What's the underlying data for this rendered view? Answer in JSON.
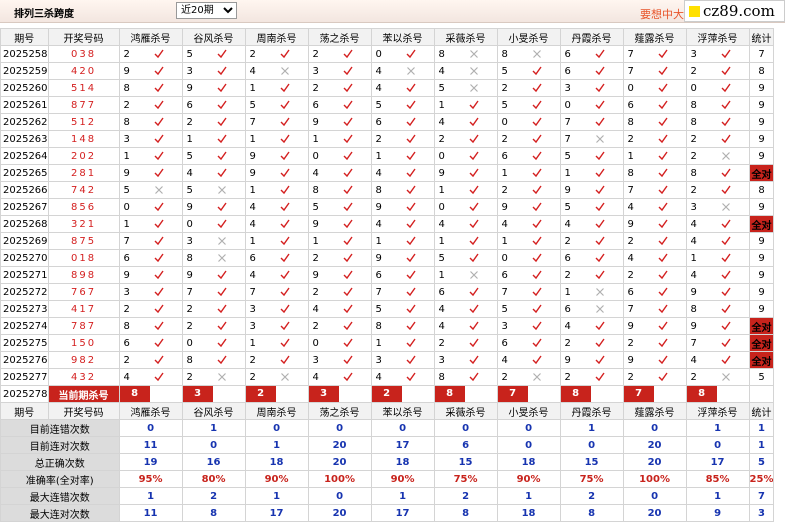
{
  "toolbar": {
    "title": "排列三杀跨度",
    "period_selected": "近20期",
    "more_text": "要想中大奖"
  },
  "logo": {
    "text": "cz89.com"
  },
  "columns": [
    "期号",
    "开奖号码",
    "鸿雁杀号",
    "谷风杀号",
    "周南杀号",
    "荡之杀号",
    "苯以杀号",
    "采薇杀号",
    "小旻杀号",
    "丹霞杀号",
    "薤露杀号",
    "浮萍杀号",
    "统计"
  ],
  "rows": [
    {
      "period": "2025258",
      "draw": "038",
      "p": [
        [
          "2",
          1
        ],
        [
          "5",
          1
        ],
        [
          "2",
          1
        ],
        [
          "2",
          1
        ],
        [
          "0",
          1
        ],
        [
          "8",
          0
        ],
        [
          "8",
          0
        ],
        [
          "6",
          1
        ],
        [
          "7",
          1
        ],
        [
          "3",
          1
        ]
      ],
      "stat": "7"
    },
    {
      "period": "2025259",
      "draw": "420",
      "p": [
        [
          "9",
          1
        ],
        [
          "3",
          1
        ],
        [
          "4",
          0
        ],
        [
          "3",
          1
        ],
        [
          "4",
          0
        ],
        [
          "4",
          0
        ],
        [
          "5",
          1
        ],
        [
          "6",
          1
        ],
        [
          "7",
          1
        ],
        [
          "2",
          1
        ]
      ],
      "stat": "8"
    },
    {
      "period": "2025260",
      "draw": "514",
      "p": [
        [
          "8",
          1
        ],
        [
          "9",
          1
        ],
        [
          "1",
          1
        ],
        [
          "2",
          1
        ],
        [
          "4",
          1
        ],
        [
          "5",
          0
        ],
        [
          "2",
          1
        ],
        [
          "3",
          1
        ],
        [
          "0",
          1
        ],
        [
          "0",
          1
        ]
      ],
      "stat": "9"
    },
    {
      "period": "2025261",
      "draw": "877",
      "p": [
        [
          "2",
          1
        ],
        [
          "6",
          1
        ],
        [
          "5",
          1
        ],
        [
          "6",
          1
        ],
        [
          "5",
          1
        ],
        [
          "1",
          1
        ],
        [
          "5",
          1
        ],
        [
          "0",
          1
        ],
        [
          "6",
          1
        ],
        [
          "8",
          1
        ]
      ],
      "stat": "9"
    },
    {
      "period": "2025262",
      "draw": "512",
      "p": [
        [
          "8",
          1
        ],
        [
          "2",
          1
        ],
        [
          "7",
          1
        ],
        [
          "9",
          1
        ],
        [
          "6",
          1
        ],
        [
          "4",
          1
        ],
        [
          "0",
          1
        ],
        [
          "7",
          1
        ],
        [
          "8",
          1
        ],
        [
          "8",
          1
        ]
      ],
      "stat": "9"
    },
    {
      "period": "2025263",
      "draw": "148",
      "p": [
        [
          "3",
          1
        ],
        [
          "1",
          1
        ],
        [
          "1",
          1
        ],
        [
          "1",
          1
        ],
        [
          "2",
          1
        ],
        [
          "2",
          1
        ],
        [
          "2",
          1
        ],
        [
          "7",
          0
        ],
        [
          "2",
          1
        ],
        [
          "2",
          1
        ]
      ],
      "stat": "9"
    },
    {
      "period": "2025264",
      "draw": "202",
      "p": [
        [
          "1",
          1
        ],
        [
          "5",
          1
        ],
        [
          "9",
          1
        ],
        [
          "0",
          1
        ],
        [
          "1",
          1
        ],
        [
          "0",
          1
        ],
        [
          "6",
          1
        ],
        [
          "5",
          1
        ],
        [
          "1",
          1
        ],
        [
          "2",
          0
        ]
      ],
      "stat": "9"
    },
    {
      "period": "2025265",
      "draw": "281",
      "p": [
        [
          "9",
          1
        ],
        [
          "4",
          1
        ],
        [
          "9",
          1
        ],
        [
          "4",
          1
        ],
        [
          "4",
          1
        ],
        [
          "9",
          1
        ],
        [
          "1",
          1
        ],
        [
          "1",
          1
        ],
        [
          "8",
          1
        ],
        [
          "8",
          1
        ]
      ],
      "stat": "全对"
    },
    {
      "period": "2025266",
      "draw": "742",
      "p": [
        [
          "5",
          0
        ],
        [
          "5",
          0
        ],
        [
          "1",
          1
        ],
        [
          "8",
          1
        ],
        [
          "8",
          1
        ],
        [
          "1",
          1
        ],
        [
          "2",
          1
        ],
        [
          "9",
          1
        ],
        [
          "7",
          1
        ],
        [
          "2",
          1
        ]
      ],
      "stat": "8"
    },
    {
      "period": "2025267",
      "draw": "856",
      "p": [
        [
          "0",
          1
        ],
        [
          "9",
          1
        ],
        [
          "4",
          1
        ],
        [
          "5",
          1
        ],
        [
          "9",
          1
        ],
        [
          "0",
          1
        ],
        [
          "9",
          1
        ],
        [
          "5",
          1
        ],
        [
          "4",
          1
        ],
        [
          "3",
          0
        ]
      ],
      "stat": "9"
    },
    {
      "period": "2025268",
      "draw": "321",
      "p": [
        [
          "1",
          1
        ],
        [
          "0",
          1
        ],
        [
          "4",
          1
        ],
        [
          "9",
          1
        ],
        [
          "4",
          1
        ],
        [
          "4",
          1
        ],
        [
          "4",
          1
        ],
        [
          "4",
          1
        ],
        [
          "9",
          1
        ],
        [
          "4",
          1
        ]
      ],
      "stat": "全对"
    },
    {
      "period": "2025269",
      "draw": "875",
      "p": [
        [
          "7",
          1
        ],
        [
          "3",
          0
        ],
        [
          "1",
          1
        ],
        [
          "1",
          1
        ],
        [
          "1",
          1
        ],
        [
          "1",
          1
        ],
        [
          "1",
          1
        ],
        [
          "2",
          1
        ],
        [
          "2",
          1
        ],
        [
          "4",
          1
        ]
      ],
      "stat": "9"
    },
    {
      "period": "2025270",
      "draw": "018",
      "p": [
        [
          "6",
          1
        ],
        [
          "8",
          0
        ],
        [
          "6",
          1
        ],
        [
          "2",
          1
        ],
        [
          "9",
          1
        ],
        [
          "5",
          1
        ],
        [
          "0",
          1
        ],
        [
          "6",
          1
        ],
        [
          "4",
          1
        ],
        [
          "1",
          1
        ]
      ],
      "stat": "9"
    },
    {
      "period": "2025271",
      "draw": "898",
      "p": [
        [
          "9",
          1
        ],
        [
          "9",
          1
        ],
        [
          "4",
          1
        ],
        [
          "9",
          1
        ],
        [
          "6",
          1
        ],
        [
          "1",
          0
        ],
        [
          "6",
          1
        ],
        [
          "2",
          1
        ],
        [
          "2",
          1
        ],
        [
          "4",
          1
        ]
      ],
      "stat": "9"
    },
    {
      "period": "2025272",
      "draw": "767",
      "p": [
        [
          "3",
          1
        ],
        [
          "7",
          1
        ],
        [
          "7",
          1
        ],
        [
          "2",
          1
        ],
        [
          "7",
          1
        ],
        [
          "6",
          1
        ],
        [
          "7",
          1
        ],
        [
          "1",
          0
        ],
        [
          "6",
          1
        ],
        [
          "9",
          1
        ]
      ],
      "stat": "9"
    },
    {
      "period": "2025273",
      "draw": "417",
      "p": [
        [
          "2",
          1
        ],
        [
          "2",
          1
        ],
        [
          "3",
          1
        ],
        [
          "4",
          1
        ],
        [
          "5",
          1
        ],
        [
          "4",
          1
        ],
        [
          "5",
          1
        ],
        [
          "6",
          0
        ],
        [
          "7",
          1
        ],
        [
          "8",
          1
        ]
      ],
      "stat": "9"
    },
    {
      "period": "2025274",
      "draw": "787",
      "p": [
        [
          "8",
          1
        ],
        [
          "2",
          1
        ],
        [
          "3",
          1
        ],
        [
          "2",
          1
        ],
        [
          "8",
          1
        ],
        [
          "4",
          1
        ],
        [
          "3",
          1
        ],
        [
          "4",
          1
        ],
        [
          "9",
          1
        ],
        [
          "9",
          1
        ]
      ],
      "stat": "全对"
    },
    {
      "period": "2025275",
      "draw": "150",
      "p": [
        [
          "6",
          1
        ],
        [
          "0",
          1
        ],
        [
          "1",
          1
        ],
        [
          "0",
          1
        ],
        [
          "1",
          1
        ],
        [
          "2",
          1
        ],
        [
          "6",
          1
        ],
        [
          "2",
          1
        ],
        [
          "2",
          1
        ],
        [
          "7",
          1
        ]
      ],
      "stat": "全对"
    },
    {
      "period": "2025276",
      "draw": "982",
      "p": [
        [
          "2",
          1
        ],
        [
          "8",
          1
        ],
        [
          "2",
          1
        ],
        [
          "3",
          1
        ],
        [
          "3",
          1
        ],
        [
          "3",
          1
        ],
        [
          "4",
          1
        ],
        [
          "9",
          1
        ],
        [
          "9",
          1
        ],
        [
          "4",
          1
        ]
      ],
      "stat": "全对"
    },
    {
      "period": "2025277",
      "draw": "432",
      "p": [
        [
          "4",
          1
        ],
        [
          "2",
          0
        ],
        [
          "2",
          0
        ],
        [
          "4",
          1
        ],
        [
          "4",
          1
        ],
        [
          "8",
          1
        ],
        [
          "2",
          0
        ],
        [
          "2",
          1
        ],
        [
          "2",
          1
        ],
        [
          "2",
          0
        ]
      ],
      "stat": "5"
    }
  ],
  "current": {
    "period": "2025278",
    "label": "当前期杀号",
    "kills": [
      "8",
      "3",
      "2",
      "3",
      "2",
      "8",
      "7",
      "8",
      "7",
      "8"
    ]
  },
  "stats": [
    {
      "label": "目前连错次数",
      "values": [
        "0",
        "1",
        "0",
        "0",
        "0",
        "0",
        "0",
        "1",
        "0",
        "1",
        "1"
      ]
    },
    {
      "label": "目前连对次数",
      "values": [
        "11",
        "0",
        "1",
        "20",
        "17",
        "6",
        "0",
        "0",
        "20",
        "0",
        "1"
      ]
    },
    {
      "label": "总正确次数",
      "values": [
        "19",
        "16",
        "18",
        "20",
        "18",
        "15",
        "18",
        "15",
        "20",
        "17",
        "5"
      ]
    },
    {
      "label": "准确率(全对率)",
      "values": [
        "95%",
        "80%",
        "90%",
        "100%",
        "90%",
        "75%",
        "90%",
        "75%",
        "100%",
        "85%",
        "25%"
      ]
    },
    {
      "label": "最大连错次数",
      "values": [
        "1",
        "2",
        "1",
        "0",
        "1",
        "2",
        "1",
        "2",
        "0",
        "1",
        "7"
      ]
    },
    {
      "label": "最大连对次数",
      "values": [
        "11",
        "8",
        "17",
        "20",
        "17",
        "8",
        "18",
        "8",
        "20",
        "9",
        "3"
      ]
    }
  ],
  "marks": {
    "ok": "check-icon",
    "no": "cross-icon"
  },
  "colors": {
    "red": "#c8231c",
    "blue": "#1734b0",
    "check": "#d42020",
    "cross": "#b0b0b0"
  }
}
